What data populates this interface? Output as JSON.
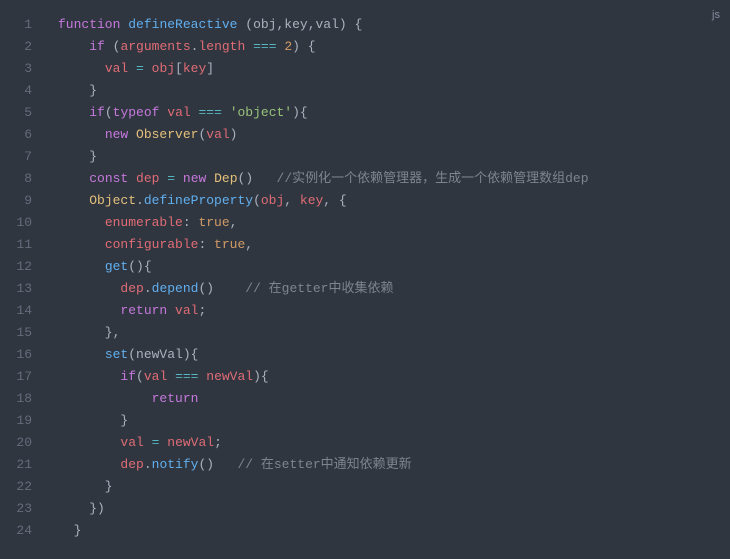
{
  "language_badge": "js",
  "line_count": 24,
  "tokens": {
    "l1": [
      [
        "kw",
        "function"
      ],
      [
        "p",
        " "
      ],
      [
        "fn",
        "defineReactive"
      ],
      [
        "p",
        " ("
      ],
      [
        "prm",
        "obj"
      ],
      [
        "p",
        ","
      ],
      [
        "prm",
        "key"
      ],
      [
        "p",
        ","
      ],
      [
        "prm",
        "val"
      ],
      [
        "p",
        ") {"
      ]
    ],
    "l2": [
      [
        "p",
        "    "
      ],
      [
        "kw",
        "if"
      ],
      [
        "p",
        " ("
      ],
      [
        "id",
        "arguments"
      ],
      [
        "p",
        "."
      ],
      [
        "id",
        "length"
      ],
      [
        "p",
        " "
      ],
      [
        "op",
        "==="
      ],
      [
        "p",
        " "
      ],
      [
        "num",
        "2"
      ],
      [
        "p",
        ") {"
      ]
    ],
    "l3": [
      [
        "p",
        "      "
      ],
      [
        "id",
        "val"
      ],
      [
        "p",
        " "
      ],
      [
        "op",
        "="
      ],
      [
        "p",
        " "
      ],
      [
        "id",
        "obj"
      ],
      [
        "p",
        "["
      ],
      [
        "id",
        "key"
      ],
      [
        "p",
        "]"
      ]
    ],
    "l4": [
      [
        "p",
        "    }"
      ]
    ],
    "l5": [
      [
        "p",
        "    "
      ],
      [
        "kw",
        "if"
      ],
      [
        "p",
        "("
      ],
      [
        "kw",
        "typeof"
      ],
      [
        "p",
        " "
      ],
      [
        "id",
        "val"
      ],
      [
        "p",
        " "
      ],
      [
        "op",
        "==="
      ],
      [
        "p",
        " "
      ],
      [
        "str",
        "'object'"
      ],
      [
        "p",
        "){"
      ]
    ],
    "l6": [
      [
        "p",
        "      "
      ],
      [
        "kw",
        "new"
      ],
      [
        "p",
        " "
      ],
      [
        "cls",
        "Observer"
      ],
      [
        "p",
        "("
      ],
      [
        "id",
        "val"
      ],
      [
        "p",
        ")"
      ]
    ],
    "l7": [
      [
        "p",
        "    }"
      ]
    ],
    "l8": [
      [
        "p",
        "    "
      ],
      [
        "kw",
        "const"
      ],
      [
        "p",
        " "
      ],
      [
        "id",
        "dep"
      ],
      [
        "p",
        " "
      ],
      [
        "op",
        "="
      ],
      [
        "p",
        " "
      ],
      [
        "kw",
        "new"
      ],
      [
        "p",
        " "
      ],
      [
        "cls",
        "Dep"
      ],
      [
        "p",
        "()   "
      ],
      [
        "cmt",
        "//实例化一个依赖管理器，生成一个依赖管理数组dep"
      ]
    ],
    "l9": [
      [
        "p",
        "    "
      ],
      [
        "obj",
        "Object"
      ],
      [
        "p",
        "."
      ],
      [
        "fn",
        "defineProperty"
      ],
      [
        "p",
        "("
      ],
      [
        "id",
        "obj"
      ],
      [
        "p",
        ", "
      ],
      [
        "id",
        "key"
      ],
      [
        "p",
        ", {"
      ]
    ],
    "l10": [
      [
        "p",
        "      "
      ],
      [
        "id",
        "enumerable"
      ],
      [
        "p",
        ": "
      ],
      [
        "bool",
        "true"
      ],
      [
        "p",
        ","
      ]
    ],
    "l11": [
      [
        "p",
        "      "
      ],
      [
        "id",
        "configurable"
      ],
      [
        "p",
        ": "
      ],
      [
        "bool",
        "true"
      ],
      [
        "p",
        ","
      ]
    ],
    "l12": [
      [
        "p",
        "      "
      ],
      [
        "fn",
        "get"
      ],
      [
        "p",
        "(){"
      ]
    ],
    "l13": [
      [
        "p",
        "        "
      ],
      [
        "id",
        "dep"
      ],
      [
        "p",
        "."
      ],
      [
        "fn",
        "depend"
      ],
      [
        "p",
        "()    "
      ],
      [
        "cmt",
        "// 在getter中收集依赖"
      ]
    ],
    "l14": [
      [
        "p",
        "        "
      ],
      [
        "kw",
        "return"
      ],
      [
        "p",
        " "
      ],
      [
        "id",
        "val"
      ],
      [
        "p",
        ";"
      ]
    ],
    "l15": [
      [
        "p",
        "      },"
      ]
    ],
    "l16": [
      [
        "p",
        "      "
      ],
      [
        "fn",
        "set"
      ],
      [
        "p",
        "("
      ],
      [
        "prm",
        "newVal"
      ],
      [
        "p",
        "){"
      ]
    ],
    "l17": [
      [
        "p",
        "        "
      ],
      [
        "kw",
        "if"
      ],
      [
        "p",
        "("
      ],
      [
        "id",
        "val"
      ],
      [
        "p",
        " "
      ],
      [
        "op",
        "==="
      ],
      [
        "p",
        " "
      ],
      [
        "id",
        "newVal"
      ],
      [
        "p",
        "){"
      ]
    ],
    "l18": [
      [
        "p",
        "            "
      ],
      [
        "kw",
        "return"
      ]
    ],
    "l19": [
      [
        "p",
        "        }"
      ]
    ],
    "l20": [
      [
        "p",
        "        "
      ],
      [
        "id",
        "val"
      ],
      [
        "p",
        " "
      ],
      [
        "op",
        "="
      ],
      [
        "p",
        " "
      ],
      [
        "id",
        "newVal"
      ],
      [
        "p",
        ";"
      ]
    ],
    "l21": [
      [
        "p",
        "        "
      ],
      [
        "id",
        "dep"
      ],
      [
        "p",
        "."
      ],
      [
        "fn",
        "notify"
      ],
      [
        "p",
        "()   "
      ],
      [
        "cmt",
        "// 在setter中通知依赖更新"
      ]
    ],
    "l22": [
      [
        "p",
        "      }"
      ]
    ],
    "l23": [
      [
        "p",
        "    })"
      ]
    ],
    "l24": [
      [
        "p",
        "  }"
      ]
    ]
  }
}
